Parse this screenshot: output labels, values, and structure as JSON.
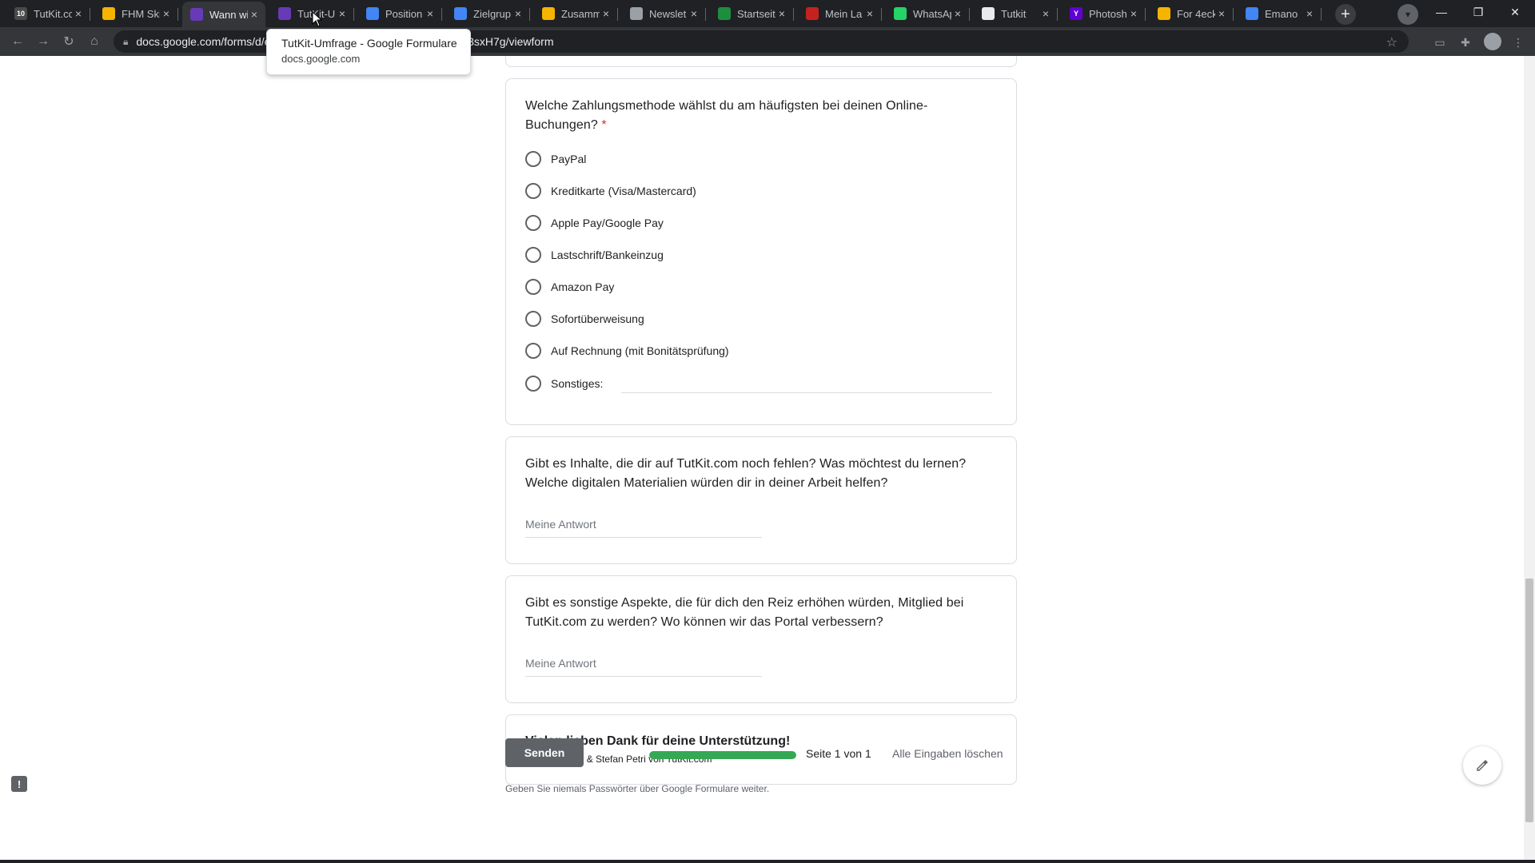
{
  "browser": {
    "tabs": [
      {
        "label": "TutKit.co",
        "favicon_color": "#4a4a4a",
        "favicon_text": "10",
        "active": false
      },
      {
        "label": "FHM Ski",
        "favicon_color": "#f4b400",
        "favicon_text": "",
        "active": false
      },
      {
        "label": "Wann wi",
        "favicon_color": "#673ab7",
        "favicon_text": "",
        "active": true
      },
      {
        "label": "TutKit-U",
        "favicon_color": "#673ab7",
        "favicon_text": "",
        "active": false
      },
      {
        "label": "Position",
        "favicon_color": "#4285f4",
        "favicon_text": "",
        "active": false
      },
      {
        "label": "Zielgrup",
        "favicon_color": "#4285f4",
        "favicon_text": "",
        "active": false
      },
      {
        "label": "Zusamm",
        "favicon_color": "#f4b400",
        "favicon_text": "",
        "active": false
      },
      {
        "label": "Newslet",
        "favicon_color": "#9aa0a6",
        "favicon_text": "",
        "active": false
      },
      {
        "label": "Startseit",
        "favicon_color": "#1e8e3e",
        "favicon_text": "",
        "active": false
      },
      {
        "label": "Mein La",
        "favicon_color": "#c5221f",
        "favicon_text": "",
        "active": false
      },
      {
        "label": "WhatsAp",
        "favicon_color": "#25d366",
        "favicon_text": "",
        "active": false
      },
      {
        "label": "Tutkit",
        "favicon_color": "#e8eaed",
        "favicon_text": "",
        "active": false
      },
      {
        "label": "Photosh",
        "favicon_color": "#6001d2",
        "favicon_text": "Y",
        "active": false
      },
      {
        "label": "For 4eck",
        "favicon_color": "#f4b400",
        "favicon_text": "",
        "active": false
      },
      {
        "label": "Emano",
        "favicon_color": "#4285f4",
        "favicon_text": "",
        "active": false
      }
    ],
    "url": "docs.google.com/forms/d/e/1FAIpQLSd_m_8vTMmIWQ-9X_Aa-BL3sxH7g/viewform",
    "tooltip": {
      "title": "TutKit-Umfrage - Google Formulare",
      "domain": "docs.google.com"
    }
  },
  "form": {
    "payment_question": {
      "title": "Welche Zahlungsmethode wählst du am häufigsten bei deinen Online-Buchungen?",
      "required_marker": "*",
      "options": [
        "PayPal",
        "Kreditkarte (Visa/Mastercard)",
        "Apple Pay/Google Pay",
        "Lastschrift/Bankeinzug",
        "Amazon Pay",
        "Sofortüberweisung",
        "Auf Rechnung (mit Bonitätsprüfung)"
      ],
      "other_label": "Sonstiges:"
    },
    "content_question": {
      "title": "Gibt es Inhalte, die dir auf TutKit.com noch fehlen? Was möchtest du lernen? Welche digitalen Materialien würden dir in deiner Arbeit helfen?",
      "placeholder": "Meine Antwort"
    },
    "aspects_question": {
      "title": "Gibt es sonstige Aspekte, die für dich den Reiz erhöhen würden, Mitglied bei TutKit.com zu werden? Wo können wir das Portal verbessern?",
      "placeholder": "Meine Antwort"
    },
    "thanks": {
      "title": "Vielen lieben Dank für deine Unterstützung!",
      "subtitle": "Dein Matthias & Stefan Petri von TutKit.com"
    },
    "submit_label": "Senden",
    "progress_fraction": 1.0,
    "page_info": "Seite 1 von 1",
    "clear_label": "Alle Eingaben löschen",
    "footnote": "Geben Sie niemals Passwörter über Google Formulare weiter."
  },
  "colors": {
    "accent_green": "#34a853",
    "required_red": "#d93025",
    "submit_gray": "#5f6368"
  }
}
